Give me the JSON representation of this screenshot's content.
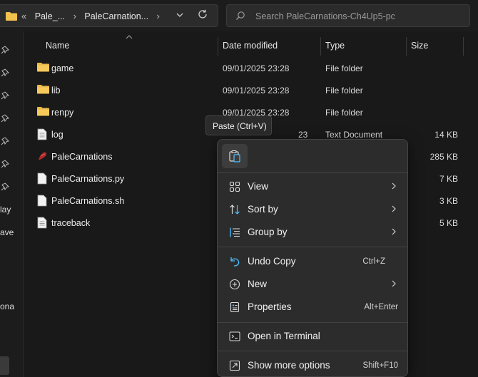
{
  "address_bar": {
    "overflow_glyph": "«",
    "crumbs": [
      "Pale_...",
      "PaleCarnation..."
    ],
    "separator": "›"
  },
  "search": {
    "placeholder": "Search PaleCarnations-Ch4Up5-pc"
  },
  "nav": {
    "fragments": [
      "lay",
      "ave",
      "ona"
    ]
  },
  "columns": {
    "name": "Name",
    "date": "Date modified",
    "type": "Type",
    "size": "Size"
  },
  "files": [
    {
      "name": "game",
      "date": "09/01/2025 23:28",
      "type": "File folder",
      "size": "",
      "icon": "folder-icon"
    },
    {
      "name": "lib",
      "date": "09/01/2025 23:28",
      "type": "File folder",
      "size": "",
      "icon": "folder-icon"
    },
    {
      "name": "renpy",
      "date": "09/01/2025 23:28",
      "type": "File folder",
      "size": "",
      "icon": "folder-icon"
    },
    {
      "name": "log",
      "date": "",
      "type": "Text Document",
      "size": "14 KB",
      "icon": "text-file-icon"
    },
    {
      "name": "PaleCarnations",
      "date": "",
      "type": "",
      "size": "285 KB",
      "icon": "app-icon"
    },
    {
      "name": "PaleCarnations.py",
      "date": "",
      "type": "",
      "size": "7 KB",
      "icon": "file-icon"
    },
    {
      "name": "PaleCarnations.sh",
      "date": "",
      "type": "",
      "size": "3 KB",
      "icon": "file-icon"
    },
    {
      "name": "traceback",
      "date": "",
      "type": "",
      "size": "5 KB",
      "icon": "text-file-icon"
    }
  ],
  "partial_date_fragment": "23",
  "tooltip": {
    "text": "Paste (Ctrl+V)"
  },
  "context_menu": {
    "items": [
      {
        "label": "View",
        "shortcut": "",
        "submenu": true,
        "icon": "grid-view-icon"
      },
      {
        "label": "Sort by",
        "shortcut": "",
        "submenu": true,
        "icon": "sort-icon"
      },
      {
        "label": "Group by",
        "shortcut": "",
        "submenu": true,
        "icon": "group-by-icon"
      },
      {
        "label": "Undo Copy",
        "shortcut": "Ctrl+Z",
        "submenu": false,
        "icon": "undo-icon"
      },
      {
        "label": "New",
        "shortcut": "",
        "submenu": true,
        "icon": "new-icon"
      },
      {
        "label": "Properties",
        "shortcut": "Alt+Enter",
        "submenu": false,
        "icon": "properties-icon"
      },
      {
        "label": "Open in Terminal",
        "shortcut": "",
        "submenu": false,
        "icon": "terminal-icon"
      },
      {
        "label": "Show more options",
        "shortcut": "Shift+F10",
        "submenu": false,
        "icon": "more-options-icon"
      }
    ]
  },
  "colors": {
    "accent": "#4cc2ff",
    "folder": "#f2c14e",
    "background": "#191919",
    "menu": "#2c2c2c"
  }
}
